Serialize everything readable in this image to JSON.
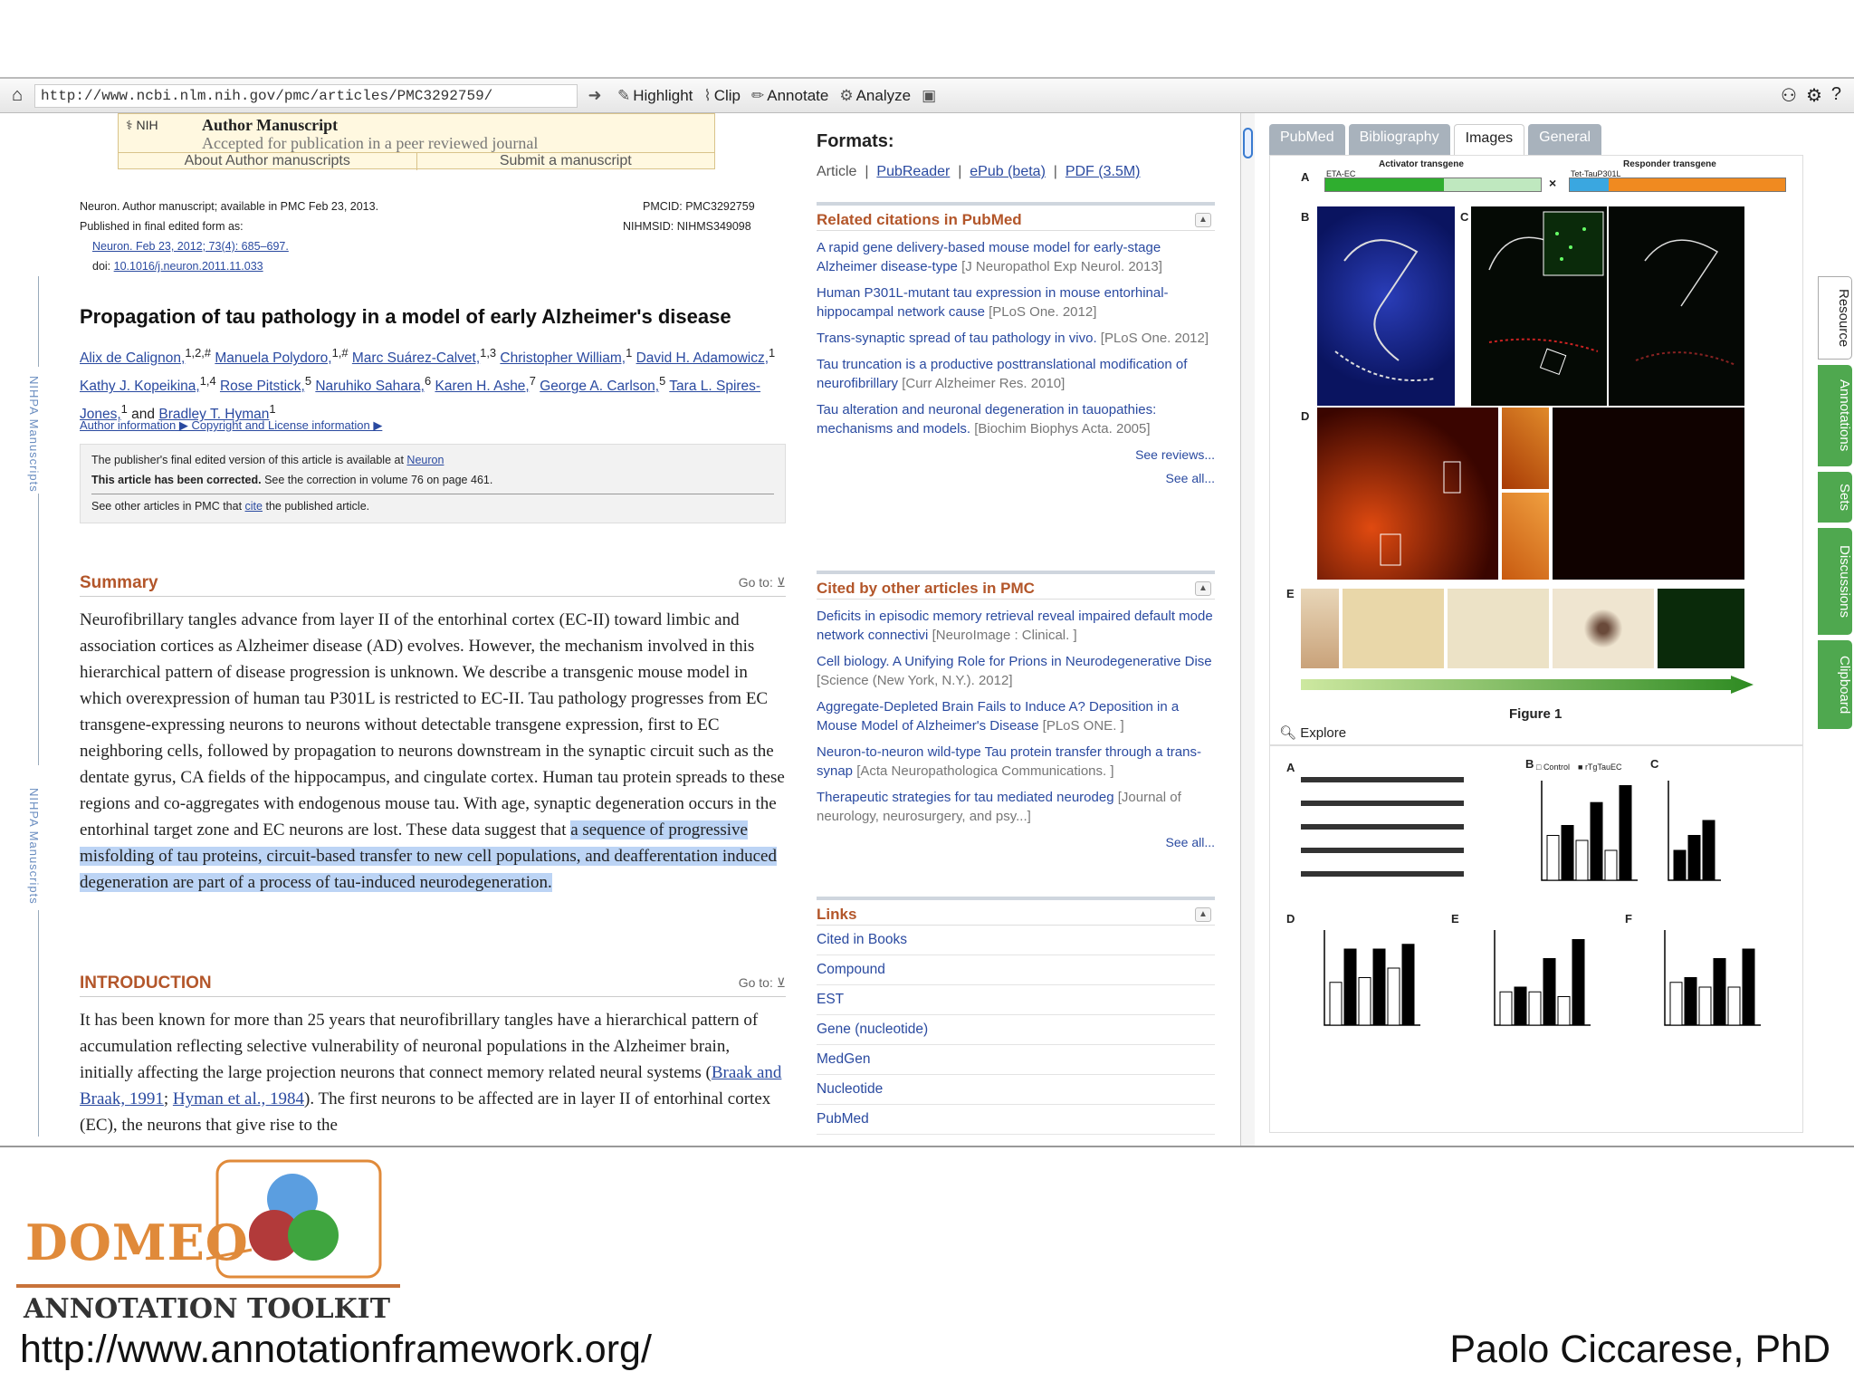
{
  "toolbar": {
    "url": "http://www.ncbi.nlm.nih.gov/pmc/articles/PMC3292759/",
    "highlight": "Highlight",
    "clip": "Clip",
    "annotate": "Annotate",
    "analyze": "Analyze"
  },
  "authorbox": {
    "title": "Author Manuscript",
    "subtitle": "Accepted for publication in a peer reviewed journal",
    "about": "About Author manuscripts",
    "submit": "Submit a manuscript"
  },
  "sidebar": {
    "label": "NIHPA Manuscripts"
  },
  "article": {
    "meta1": "Neuron. Author manuscript; available in PMC Feb 23, 2013.",
    "meta2": "Published in final edited form as:",
    "meta3": "Neuron. Feb 23, 2012; 73(4): 685–697.",
    "doi_label": "doi:",
    "doi": "10.1016/j.neuron.2011.11.033",
    "pmcid": "PMCID: PMC3292759",
    "nihmsid": "NIHMSID: NIHMS349098",
    "title": "Propagation of tau pathology in a model of early Alzheimer's disease",
    "authors": [
      "Alix de Calignon,",
      "Manuela Polydoro,",
      "Marc Suárez-Calvet,",
      "Christopher William,",
      "David H. Adamowicz,",
      "Kathy J. Kopeikina,",
      "Rose Pitstick,",
      "Naruhiko Sahara,",
      "Karen H. Ashe,",
      "George A. Carlson,",
      "Tara L. Spires-Jones,",
      "and",
      "Bradley T. Hyman"
    ],
    "author_sups": [
      "1,2,#",
      "1,#",
      "1,3",
      "1",
      "1",
      "1,4",
      "5",
      "6",
      "7",
      "5",
      "1",
      "",
      "1"
    ],
    "author_info": "Author information ▶ Copyright and License information ▶",
    "pub_final": "The publisher's final edited version of this article is available at",
    "pub_final_link": "Neuron",
    "corrected_bold": "This article has been corrected.",
    "corrected_rest": "See the correction in volume 76 on page 461.",
    "see_other_pre": "See other articles in PMC that",
    "see_other_link": "cite",
    "see_other_post": "the published article.",
    "summary_head": "Summary",
    "goto": "Go to:",
    "summary_text": "Neurofibrillary tangles advance from layer II of the entorhinal cortex (EC-II) toward limbic and association cortices as Alzheimer disease (AD) evolves. However, the mechanism involved in this hierarchical pattern of disease progression is unknown. We describe a transgenic mouse model in which overexpression of human tau P301L is restricted to EC-II. Tau pathology progresses from EC transgene-expressing neurons to neurons without detectable transgene expression, first to EC neighboring cells, followed by propagation to neurons downstream in the synaptic circuit such as the dentate gyrus, CA fields of the hippocampus, and cingulate cortex. Human tau protein spreads to these regions and co-aggregates with endogenous mouse tau. With age, synaptic degeneration occurs in the entorhinal target zone and EC neurons are lost. These data suggest that",
    "summary_highlight": "a sequence of progressive misfolding of tau proteins, circuit-based transfer to new cell populations, and deafferentation induced degeneration are part of a process of tau-induced neurodegeneration.",
    "intro_head": "INTRODUCTION",
    "intro_text": "It has been known for more than 25 years that neurofibrillary tangles have a hierarchical pattern of accumulation reflecting selective vulnerability of neuronal populations in the Alzheimer brain, initially affecting the large projection neurons that connect memory related neural systems (",
    "intro_cite1": "Braak and Braak, 1991",
    "intro_sep": "; ",
    "intro_cite2": "Hyman et al., 1984",
    "intro_text2": "). The first neurons to be affected are in layer II of entorhinal cortex (EC), the neurons that give rise to the"
  },
  "middle": {
    "formats": "Formats:",
    "format_links": [
      "Article",
      "PubReader",
      "ePub (beta)",
      "PDF (3.5M)"
    ],
    "related_head": "Related citations in PubMed",
    "related": [
      {
        "t": "A rapid gene delivery-based mouse model for early-stage Alzheimer disease-type",
        "s": "[J Neuropathol Exp Neurol. 2013]"
      },
      {
        "t": "Human P301L-mutant tau expression in mouse entorhinal-hippocampal network cause",
        "s": "[PLoS One. 2012]"
      },
      {
        "t": "Trans-synaptic spread of tau pathology in vivo.",
        "s": "[PLoS One. 2012]"
      },
      {
        "t": "Tau truncation is a productive posttranslational modification of neurofibrillary",
        "s": "[Curr Alzheimer Res. 2010]"
      },
      {
        "t": "Tau alteration and neuronal degeneration in tauopathies: mechanisms and models.",
        "s": "[Biochim Biophys Acta. 2005]"
      }
    ],
    "see_reviews": "See reviews...",
    "see_all": "See all...",
    "cited_head": "Cited by other articles in PMC",
    "cited": [
      {
        "t": "Deficits in episodic memory retrieval reveal impaired default mode network connectivi",
        "s": "[NeuroImage : Clinical. ]"
      },
      {
        "t": "Cell biology. A Unifying Role for Prions in Neurodegenerative Dise",
        "s": "[Science (New York, N.Y.). 2012]"
      },
      {
        "t": "Aggregate-Depleted Brain Fails to Induce A? Deposition in a Mouse Model of Alzheimer's Disease",
        "s": "[PLoS ONE. ]"
      },
      {
        "t": "Neuron-to-neuron wild-type Tau protein transfer through a trans-synap",
        "s": "[Acta Neuropathologica Communications. ]"
      },
      {
        "t": "Therapeutic strategies for tau mediated neurodeg",
        "s": "[Journal of neurology, neurosurgery, and psy...]"
      }
    ],
    "links_head": "Links",
    "links": [
      "Cited in Books",
      "Compound",
      "EST",
      "Gene (nucleotide)",
      "MedGen",
      "Nucleotide",
      "PubMed"
    ]
  },
  "right": {
    "tabs": [
      "PubMed",
      "Bibliography",
      "Images",
      "General"
    ],
    "active_tab": "Images",
    "side_tabs": [
      "Resource",
      "Annotations",
      "Sets",
      "Discussions",
      "Clipboard"
    ],
    "figure_caption": "Figure 1",
    "explore": "Explore",
    "activator": "Activator transgene",
    "responder": "Responder transgene",
    "eta_ec": "ETA-EC",
    "tet_tau": "Tet-TauP301L",
    "panel_letters": [
      "A",
      "B",
      "C",
      "D",
      "E",
      "A",
      "B",
      "C",
      "D",
      "E",
      "F"
    ],
    "legend_control": "Control",
    "legend_rtg": "rTgTauEC"
  },
  "footer": {
    "brand": "DOMEO",
    "tagline": "ANNOTATION TOOLKIT",
    "url": "http://www.annotationframework.org/",
    "author": "Paolo Ciccarese, PhD"
  },
  "colors": {
    "accent": "#b3562a",
    "link": "#2a4aa0",
    "tab_green": "#4fa84f",
    "highlight": "#bcd4f5"
  }
}
